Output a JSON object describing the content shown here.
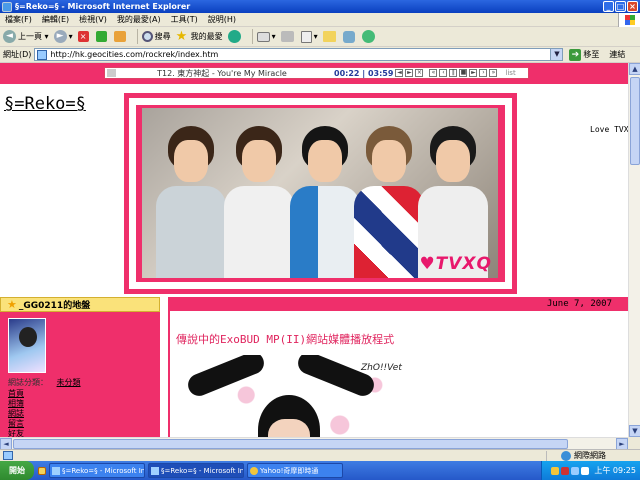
{
  "window": {
    "title": "§=Reko=§ - Microsoft Internet Explorer",
    "controls": [
      "_",
      "□",
      "×"
    ]
  },
  "menu": [
    "檔案(F)",
    "編輯(E)",
    "檢視(V)",
    "我的最愛(A)",
    "工具(T)",
    "說明(H)"
  ],
  "toolbar": {
    "back": "上一頁",
    "search": "搜尋",
    "favorites": "我的最愛"
  },
  "address": {
    "label": "網址(D)",
    "url": "http://hk.geocities.com/rockrek/index.htm",
    "go": "移至",
    "links": "連結"
  },
  "player": {
    "song": "T12. 東方神起 - You're My Miracle",
    "time": "00:22 | 03:59",
    "list": "list"
  },
  "site": {
    "title": "§=Reko=§",
    "banner_logo": "♥TVXQ",
    "side_text": "Love TVX"
  },
  "profile": {
    "heading": "_GG0211的地盤",
    "category_label": "網誌分類：",
    "category_value": "未分類",
    "links": [
      "首頁",
      "相簿",
      "網誌",
      "留言",
      "好友"
    ]
  },
  "post": {
    "date": "June 7, 2007",
    "title": "傳說中的ExoBUD MP(II)網站媒體播放程式",
    "image_sign": "ZhO!!Vet"
  },
  "status": {
    "zone": "網際網路"
  },
  "taskbar": {
    "start": "開始",
    "tasks": [
      "§=Reko=§ - Microsoft In...",
      "§=Reko=§ - Microsoft Inte...",
      "Yahoo!奇摩即時通"
    ],
    "clock": "上午 09:25"
  },
  "colors": {
    "accent_pink": "#ef2f6b",
    "title_pink": "#e0245e",
    "xp_blue": "#2558c9"
  }
}
